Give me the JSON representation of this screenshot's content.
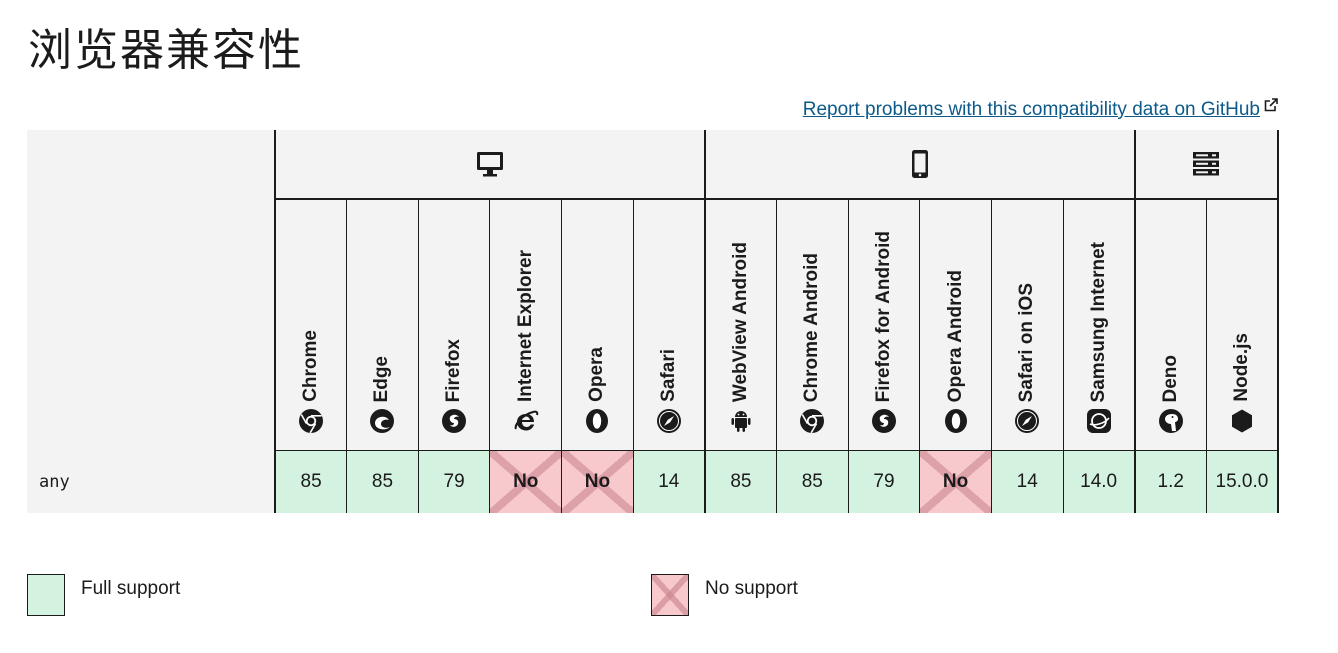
{
  "page": {
    "title": "浏览器兼容性"
  },
  "report_link": {
    "label": "Report problems with this compatibility data on GitHub",
    "icon": "external-link-icon"
  },
  "platforms": [
    {
      "name": "desktop",
      "icon": "desktop-icon"
    },
    {
      "name": "mobile",
      "icon": "mobile-icon"
    },
    {
      "name": "server",
      "icon": "server-icon"
    }
  ],
  "browsers": [
    {
      "name": "Chrome",
      "icon": "chrome-icon"
    },
    {
      "name": "Edge",
      "icon": "edge-icon"
    },
    {
      "name": "Firefox",
      "icon": "firefox-icon"
    },
    {
      "name": "Internet Explorer",
      "icon": "internet-explorer-icon"
    },
    {
      "name": "Opera",
      "icon": "opera-icon"
    },
    {
      "name": "Safari",
      "icon": "safari-icon"
    },
    {
      "name": "WebView Android",
      "icon": "android-icon"
    },
    {
      "name": "Chrome Android",
      "icon": "chrome-icon"
    },
    {
      "name": "Firefox for Android",
      "icon": "firefox-icon"
    },
    {
      "name": "Opera Android",
      "icon": "opera-icon"
    },
    {
      "name": "Safari on iOS",
      "icon": "safari-icon"
    },
    {
      "name": "Samsung Internet",
      "icon": "samsung-internet-icon"
    },
    {
      "name": "Deno",
      "icon": "deno-icon"
    },
    {
      "name": "Node.js",
      "icon": "nodejs-icon"
    }
  ],
  "rows": [
    {
      "feature": "any",
      "support": [
        {
          "value": "85",
          "status": "yes"
        },
        {
          "value": "85",
          "status": "yes"
        },
        {
          "value": "79",
          "status": "yes"
        },
        {
          "value": "No",
          "status": "no"
        },
        {
          "value": "No",
          "status": "no"
        },
        {
          "value": "14",
          "status": "yes"
        },
        {
          "value": "85",
          "status": "yes"
        },
        {
          "value": "85",
          "status": "yes"
        },
        {
          "value": "79",
          "status": "yes"
        },
        {
          "value": "No",
          "status": "no"
        },
        {
          "value": "14",
          "status": "yes"
        },
        {
          "value": "14.0",
          "status": "yes"
        },
        {
          "value": "1.2",
          "status": "yes"
        },
        {
          "value": "15.0.0",
          "status": "yes"
        }
      ]
    }
  ],
  "legend": {
    "full": "Full support",
    "none": "No support"
  },
  "colors": {
    "full_support": "#d4f2e0",
    "no_support": "#f7c9cd",
    "link": "#0b5a8a"
  }
}
